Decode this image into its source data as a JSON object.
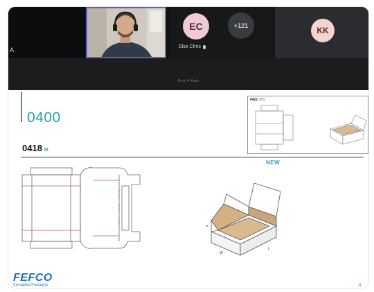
{
  "meeting": {
    "left_tile_text": "A",
    "participants": [
      {
        "initials": "EC",
        "name": "Else Chris"
      },
      {
        "initials": "KK",
        "name": ""
      }
    ],
    "more_count": "+121",
    "share_text": "Gen 4 Xxxx"
  },
  "slide": {
    "code": "0400",
    "subcode": "0418",
    "subcode_suffix": "M",
    "preview_code": "0421",
    "preview_suffix": "M/S",
    "new_label": "NEW",
    "logo_text": "FEFCO",
    "logo_subtext": "Corrugated Packaging",
    "page_number": "8",
    "dim_labels": {
      "w": "W",
      "h": "H",
      "l": "L"
    }
  },
  "colors": {
    "accent": "#2a9fb0",
    "logo": "#1b6fc4",
    "call_highlight": "#5b5fc7",
    "cardboard": "#d9b98f"
  }
}
